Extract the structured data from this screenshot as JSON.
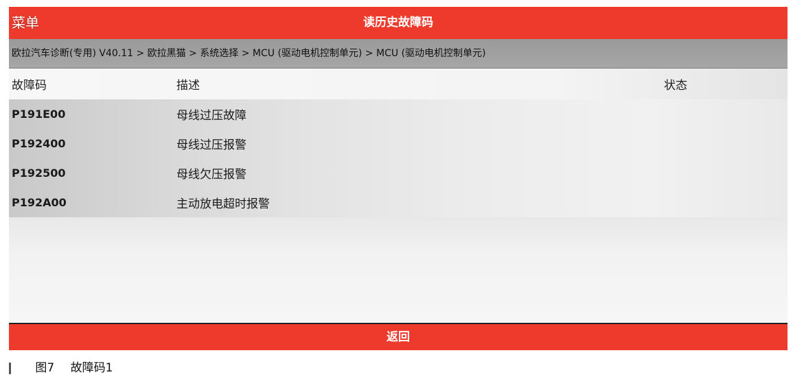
{
  "header": {
    "menu_label": "菜单",
    "title": "读历史故障码"
  },
  "breadcrumb": {
    "text": "欧拉汽车诊断(专用) V40.11 > 欧拉黑猫 > 系统选择 > MCU (驱动电机控制单元) > MCU (驱动电机控制单元)"
  },
  "table": {
    "columns": {
      "code": "故障码",
      "description": "描述",
      "status": "状态"
    },
    "rows": [
      {
        "code": "P191E00",
        "description": "母线过压故障",
        "status": ""
      },
      {
        "code": "P192400",
        "description": "母线过压报警",
        "status": ""
      },
      {
        "code": "P192500",
        "description": "母线欠压报警",
        "status": ""
      },
      {
        "code": "P192A00",
        "description": "主动放电超时报警",
        "status": ""
      }
    ]
  },
  "footer": {
    "back_label": "返回"
  },
  "caption": {
    "figure": "图7",
    "title": "故障码1"
  },
  "colors": {
    "accent_red": "#ee3a2c",
    "breadcrumb_gray": "#a0a0a0"
  }
}
